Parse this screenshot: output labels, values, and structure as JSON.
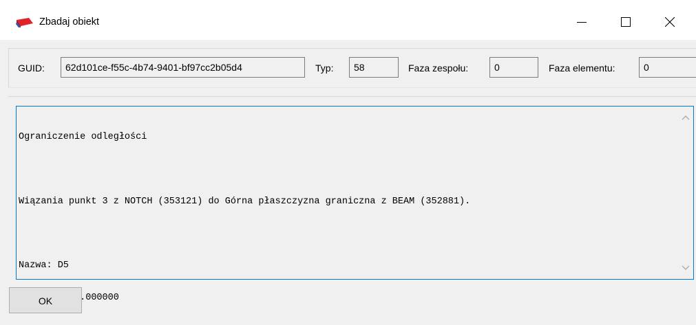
{
  "window": {
    "title": "Zbadaj obiekt",
    "icon": "app-red-flag-icon",
    "controls": [
      "minimize-icon",
      "maximize-icon",
      "close-icon"
    ]
  },
  "fields": {
    "guid_label": "GUID:",
    "guid_value": "62d101ce-f55c-4b74-9401-bf97cc2b05d4",
    "type_label": "Typ:",
    "type_value": "58",
    "assembly_phase_label": "Faza zespołu:",
    "assembly_phase_value": "0",
    "element_phase_label": "Faza elementu:",
    "element_phase_value": "0"
  },
  "details": {
    "lines": [
      "Ograniczenie odległości",
      "",
      "Wiązania punkt 3 z NOTCH (353121) do Górna płaszczyzna graniczna z BEAM (352881).",
      "",
      "Nazwa: D5",
      "Długość: 10.000000"
    ]
  },
  "buttons": {
    "ok_label": "OK"
  },
  "colors": {
    "focus_border": "#0078d7",
    "icon_red": "#e0232b"
  }
}
